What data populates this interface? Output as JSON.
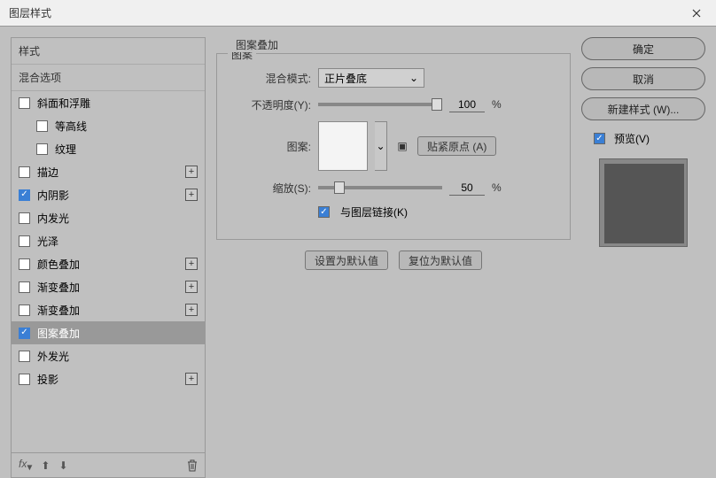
{
  "window": {
    "title": "图层样式"
  },
  "left": {
    "header1": "样式",
    "header2": "混合选项",
    "items": [
      {
        "label": "斜面和浮雕",
        "checked": false,
        "plus": false,
        "indent": false
      },
      {
        "label": "等高线",
        "checked": false,
        "plus": false,
        "indent": true,
        "nocb": false
      },
      {
        "label": "纹理",
        "checked": false,
        "plus": false,
        "indent": true,
        "nocb": false
      },
      {
        "label": "描边",
        "checked": false,
        "plus": true,
        "indent": false
      },
      {
        "label": "内阴影",
        "checked": true,
        "plus": true,
        "indent": false
      },
      {
        "label": "内发光",
        "checked": false,
        "plus": false,
        "indent": false
      },
      {
        "label": "光泽",
        "checked": false,
        "plus": false,
        "indent": false
      },
      {
        "label": "颜色叠加",
        "checked": false,
        "plus": true,
        "indent": false
      },
      {
        "label": "渐变叠加",
        "checked": false,
        "plus": true,
        "indent": false
      },
      {
        "label": "渐变叠加",
        "checked": false,
        "plus": true,
        "indent": false
      },
      {
        "label": "图案叠加",
        "checked": true,
        "plus": false,
        "indent": false,
        "selected": true
      },
      {
        "label": "外发光",
        "checked": false,
        "plus": false,
        "indent": false
      },
      {
        "label": "投影",
        "checked": false,
        "plus": true,
        "indent": false
      }
    ],
    "footer_fx": "fx"
  },
  "center": {
    "group_title": "图案叠加",
    "pattern_legend": "图案",
    "blend_mode_label": "混合模式:",
    "blend_mode_value": "正片叠底",
    "opacity_label": "不透明度(Y):",
    "opacity_value": "100",
    "opacity_suffix": "%",
    "pattern_label": "图案:",
    "snap_button": "贴紧原点 (A)",
    "scale_label": "缩放(S):",
    "scale_value": "50",
    "scale_suffix": "%",
    "link_label": "与图层链接(K)",
    "set_default": "设置为默认值",
    "reset_default": "复位为默认值"
  },
  "right": {
    "ok": "确定",
    "cancel": "取消",
    "new_style": "新建样式 (W)...",
    "preview": "预览(V)"
  }
}
